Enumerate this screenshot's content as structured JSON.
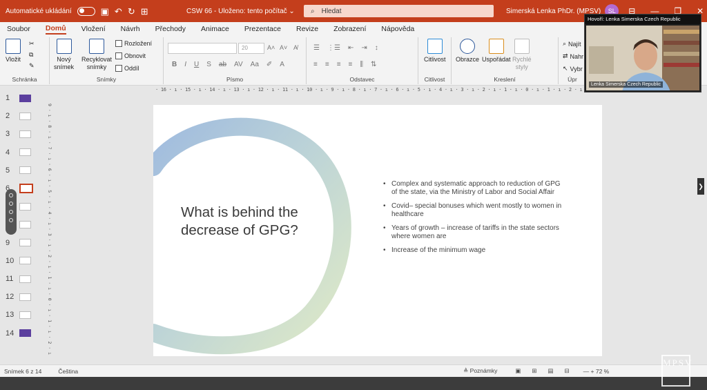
{
  "titlebar": {
    "autosave_label": "Automatické ukládání",
    "doc_title": "CSW 66 - Uloženo: tento počítač",
    "doc_title_chevron": "⌄",
    "search_placeholder": "Hledat",
    "user_name": "Simerská Lenka PhDr. (MPSV)",
    "user_initials": "SL"
  },
  "menu": [
    "Soubor",
    "Domů",
    "Vložení",
    "Návrh",
    "Přechody",
    "Animace",
    "Prezentace",
    "Revize",
    "Zobrazení",
    "Nápověda"
  ],
  "menu_active_index": 1,
  "ribbon": {
    "vlozit": "Vložit",
    "schranka": "Schránka",
    "novy": "Nový",
    "snimek": "snímek",
    "recyklovat": "Recyklovat",
    "snimky_btn": "snímky",
    "rozlozeni": "Rozložení",
    "obnovit": "Obnovit",
    "oddil": "Oddíl",
    "snimky_group": "Snímky",
    "font_size": "20",
    "pismo": "Písmo",
    "odstavec": "Odstavec",
    "citlivost": "Citlivost",
    "obrazce": "Obrazce",
    "usporadat": "Uspořádat",
    "rychle": "Rychlé",
    "styly": "styly",
    "kresleni": "Kreslení",
    "najit": "Najít",
    "nahradit": "Nahr",
    "vybrat": "Vybr",
    "upravy": "Úpr"
  },
  "ruler_top": "· 16 · ı · 15 · ı · 14 · ı · 13 · ı · 12 · ı · 11 · ı · 10 · ı · 9 · ı · 8 · ı · 7 · ı · 6 · ı · 5 · ı · 4 · ı · 3 · ı · 2 · ı · 1 · ı · 0 · ı · 1 · ı · 2 · ı · 3 · ı · 4 · ı · 5 · ı · 6 · ı · 7 · ı · 8 · ı · 9 · ı · 10 · ı · 11 · ı · 12 · ı · 13 · ı · 14 · ı · 15 · ı · 16",
  "ruler_left": "9 · ı · 8 · ı · 7 · ı · 6 · ı · 5 · ı · 4 · ı · 3 · ı · 2 · ı · 1 · ı · 0 · ı · 1 · ı · 2 · ı · 3 · ı · 4 · ı · 5 · ı · 6 · ı · 7 · ı · 8 · ı · 9",
  "thumbnails": [
    {
      "num": "1",
      "style": "purple"
    },
    {
      "num": "2",
      "style": "plain"
    },
    {
      "num": "3",
      "style": "plain"
    },
    {
      "num": "4",
      "style": "plain"
    },
    {
      "num": "5",
      "style": "plain"
    },
    {
      "num": "6",
      "style": "selected"
    },
    {
      "num": "7",
      "style": "plain"
    },
    {
      "num": "8",
      "style": "plain"
    },
    {
      "num": "9",
      "style": "plain"
    },
    {
      "num": "10",
      "style": "plain"
    },
    {
      "num": "11",
      "style": "plain"
    },
    {
      "num": "12",
      "style": "plain"
    },
    {
      "num": "13",
      "style": "plain"
    },
    {
      "num": "14",
      "style": "purple"
    }
  ],
  "slide": {
    "title": "What is behind the decrease of GPG?",
    "bullets": [
      "Complex and systematic approach to reduction of GPG of the state, via the Ministry of Labor and Social Affair",
      "Covid– special bonuses which went mostly to women in healthcare",
      "Years of growth – increase of tariffs in the state sectors where women are",
      "Increase of the minimum wage"
    ]
  },
  "video": {
    "call_label": "Hovoří: Lenka Simerska Czech Republic",
    "name_label": "Lenka Simerska Czech Republic"
  },
  "status": {
    "slide_count": "Snímek 6 z 14",
    "language": "Čeština",
    "notes": "Poznámky",
    "zoom": "— + 72 %"
  },
  "watermark": "MPSV",
  "colors": {
    "accent": "#c43e1c",
    "ring_blue": "#8fb0d6",
    "ring_green": "#c9dba8"
  }
}
